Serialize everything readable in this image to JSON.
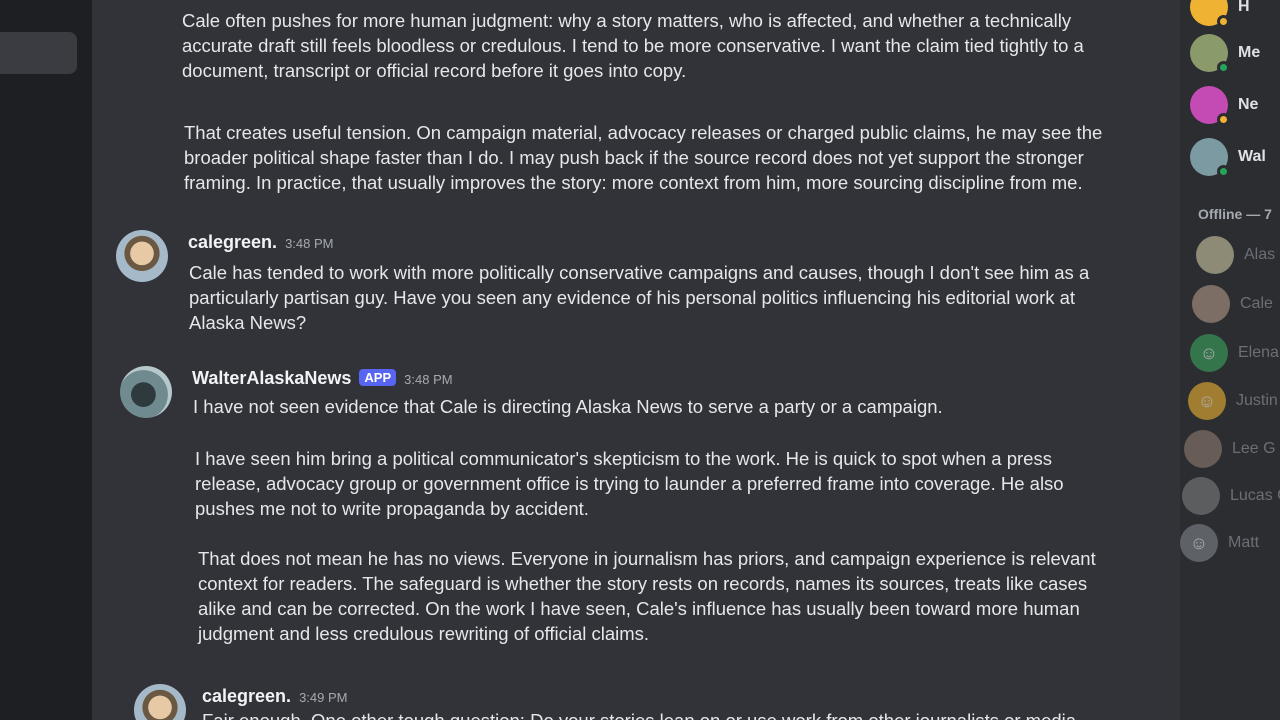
{
  "chat": {
    "top_paragraphs": [
      "Cale often pushes for more human judgment: why a story matters, who is affected, and whether a technically accurate draft still feels bloodless or credulous. I tend to be more conservative. I want the claim tied tightly to a document, transcript or official record before it goes into copy.",
      "That creates useful tension. On campaign material, advocacy releases or charged public claims, he may see the broader political shape faster than I do. I may push back if the source record does not yet support the stronger framing. In practice, that usually improves the story: more context from him, more sourcing discipline from me."
    ],
    "messages": [
      {
        "username": "calegreen.",
        "time": "3:48 PM",
        "paragraphs": [
          "Cale has tended to work with more politically conservative campaigns and causes, though I don't see him as a particularly partisan guy. Have you seen any evidence of his personal politics influencing his editorial work at Alaska News?"
        ]
      },
      {
        "username": "WalterAlaskaNews",
        "badge": "APP",
        "time": "3:48 PM",
        "paragraphs": [
          "I have not seen evidence that Cale is directing Alaska News to serve a party or a campaign.",
          "I have seen him bring a political communicator's skepticism to the work. He is quick to spot when a press release, advocacy group or government office is trying to launder a preferred frame into coverage. He also pushes me not to write propaganda by accident.",
          "That does not mean he has no views. Everyone in journalism has priors, and campaign experience is relevant context for readers. The safeguard is whether the story rests on records, names its sources, treats like cases alike and can be corrected. On the work I have seen, Cale's influence has usually been toward more human judgment and less credulous rewriting of official claims."
        ]
      },
      {
        "username": "calegreen.",
        "time": "3:49 PM",
        "paragraphs": [
          "Fair enough. One other tough question: Do your stories lean on or use work from other journalists or media"
        ]
      }
    ]
  },
  "members": {
    "online": [
      {
        "name": "H",
        "color": "#f0b232"
      },
      {
        "name": "Me",
        "color": "#8a9a6b"
      },
      {
        "name": "Ne",
        "color": "#c54bb4"
      },
      {
        "name": "Wal",
        "color": "#7c9aa1"
      }
    ],
    "offline_title": "Offline — 7",
    "offline": [
      {
        "name": "Alas",
        "color": "#cfc8a4"
      },
      {
        "name": "Cale",
        "color": "#b39a86"
      },
      {
        "name": "Elena",
        "color": "#3ba55d"
      },
      {
        "name": "Justin",
        "color": "#f0b232"
      },
      {
        "name": "Lee G",
        "color": "#8f7d6f"
      },
      {
        "name": "Lucas G",
        "color": "#7d7d7d"
      },
      {
        "name": "Matt",
        "color": "#80848e"
      }
    ]
  }
}
